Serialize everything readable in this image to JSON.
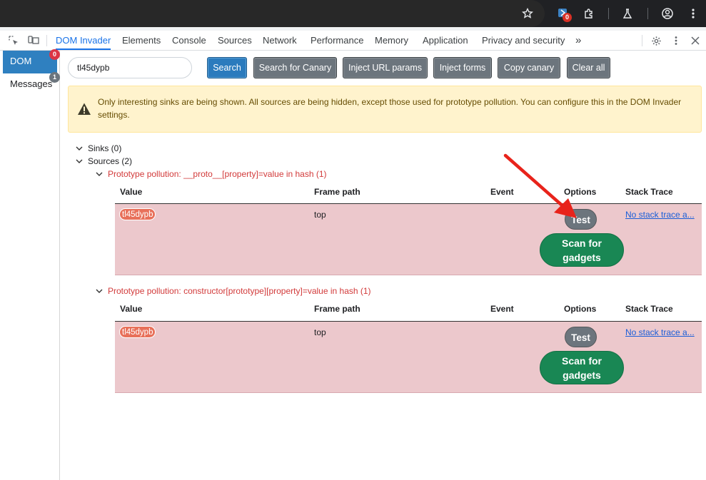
{
  "devtools": {
    "tabs": [
      {
        "label": "DOM Invader"
      },
      {
        "label": "Elements"
      },
      {
        "label": "Console"
      },
      {
        "label": "Sources"
      },
      {
        "label": "Network"
      },
      {
        "label": "Performance"
      },
      {
        "label": "Memory"
      },
      {
        "label": "Application"
      },
      {
        "label": "Privacy and security"
      }
    ],
    "more_label": "»"
  },
  "browser": {
    "extension_badge": "0"
  },
  "sidebar": {
    "items": [
      {
        "label": "DOM",
        "badge": "0"
      },
      {
        "label": "Messages",
        "badge": "1"
      }
    ]
  },
  "toolbar": {
    "search_value": "tl45dypb",
    "buttons": {
      "search": "Search",
      "search_canary": "Search for Canary",
      "inject_url": "Inject URL params",
      "inject_forms": "Inject forms",
      "copy_canary": "Copy canary",
      "clear_all": "Clear all"
    }
  },
  "alert": {
    "text": "Only interesting sinks are being shown. All sources are being hidden, except those used for prototype pollution. You can configure this in the DOM Invader settings."
  },
  "tree": {
    "sinks_label": "Sinks (0)",
    "sources_label": "Sources (2)"
  },
  "groups": [
    {
      "title": "Prototype pollution: __proto__[property]=value in hash (1)",
      "headers": {
        "value": "Value",
        "frame": "Frame path",
        "event": "Event",
        "options": "Options",
        "stack": "Stack Trace"
      },
      "row": {
        "value": "tl45dypb",
        "frame": "top",
        "test": "Test",
        "scan": "Scan for gadgets",
        "stack": "No stack trace a..."
      }
    },
    {
      "title": "Prototype pollution: constructor[prototype][property]=value in hash (1)",
      "headers": {
        "value": "Value",
        "frame": "Frame path",
        "event": "Event",
        "options": "Options",
        "stack": "Stack Trace"
      },
      "row": {
        "value": "tl45dypb",
        "frame": "top",
        "test": "Test",
        "scan": "Scan for gadgets",
        "stack": "No stack trace a..."
      }
    }
  ],
  "colors": {
    "accent": "#1a73e8",
    "row_bg": "#ecc8cc",
    "warning_bg": "#fff3cd",
    "scan_green": "#198754",
    "arrow_red": "#e8231b"
  }
}
